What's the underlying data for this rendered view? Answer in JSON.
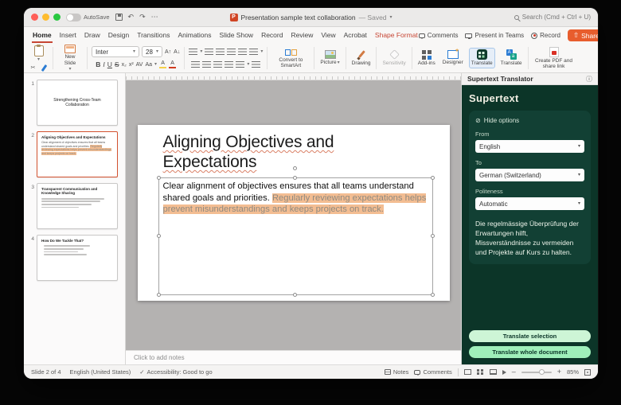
{
  "window": {
    "autosave_label": "AutoSave",
    "doc_title": "Presentation sample text collaboration",
    "saved_status": "— Saved",
    "search_text": "Search (Cmd + Ctrl + U)"
  },
  "tabs": [
    "Home",
    "Insert",
    "Draw",
    "Design",
    "Transitions",
    "Animations",
    "Slide Show",
    "Record",
    "Review",
    "View",
    "Acrobat",
    "Shape Format"
  ],
  "actions": {
    "comments": "Comments",
    "present_teams": "Present in Teams",
    "record": "Record",
    "share": "Share"
  },
  "ribbon": {
    "new_slide": "New Slide",
    "font_name": "Inter",
    "font_size": "28",
    "bold": "B",
    "italic": "I",
    "underline": "U",
    "strike": "S",
    "subscript": "x₂",
    "superscript": "x²",
    "spacing": "AV",
    "change_case": "Aa",
    "highlight_letter": "A",
    "font_color_letter": "A",
    "grow_font": "A↑",
    "shrink_font": "A↓",
    "convert_smartart": "Convert to SmartArt",
    "picture": "Picture",
    "drawing": "Drawing",
    "sensitivity": "Sensitivity",
    "addins": "Add-ins",
    "designer": "Designer",
    "translate_supertext": "Translate",
    "translate_office": "Translate",
    "create_pdf": "Create PDF and share link"
  },
  "slides": [
    {
      "num": "1",
      "title": "Strengthening Cross-Team Collaboration"
    },
    {
      "num": "2",
      "title": "Aligning Objectives and Expectations"
    },
    {
      "num": "3",
      "title": "Transparent Communication and Knowledge Sharing"
    },
    {
      "num": "4",
      "title": "How Do We Tackle That?"
    }
  ],
  "slide": {
    "title": "Aligning Objectives and Expectations",
    "body_plain": "Clear alignment of objectives ensures that all teams understand shared goals and priorities. ",
    "body_highlighted": "Regularly reviewing expectations helps prevent misunderstandings and keeps projects on track."
  },
  "notes": {
    "placeholder": "Click to add notes"
  },
  "supertext": {
    "header": "Supertext Translator",
    "brand": "Supertext",
    "hide_options": "Hide options",
    "from_label": "From",
    "from_value": "English",
    "to_label": "To",
    "to_value": "German (Switzerland)",
    "politeness_label": "Politeness",
    "politeness_value": "Automatic",
    "translation": "Die regelmässige Überprüfung der Erwartungen hilft, Missverständnisse zu vermeiden und Projekte auf Kurs zu halten.",
    "btn_selection": "Translate selection",
    "btn_document": "Translate whole document"
  },
  "statusbar": {
    "slide_info": "Slide 2 of 4",
    "language": "English (United States)",
    "accessibility": "Accessibility: Good to go",
    "notes": "Notes",
    "comments": "Comments",
    "zoom": "85%"
  },
  "colors": {
    "accent": "#d35230",
    "share_button": "#e85d2d",
    "panel_dark": "#0c3528",
    "panel_card": "#124034",
    "button_green": "#9fefba",
    "highlight": "#f3bd92"
  }
}
